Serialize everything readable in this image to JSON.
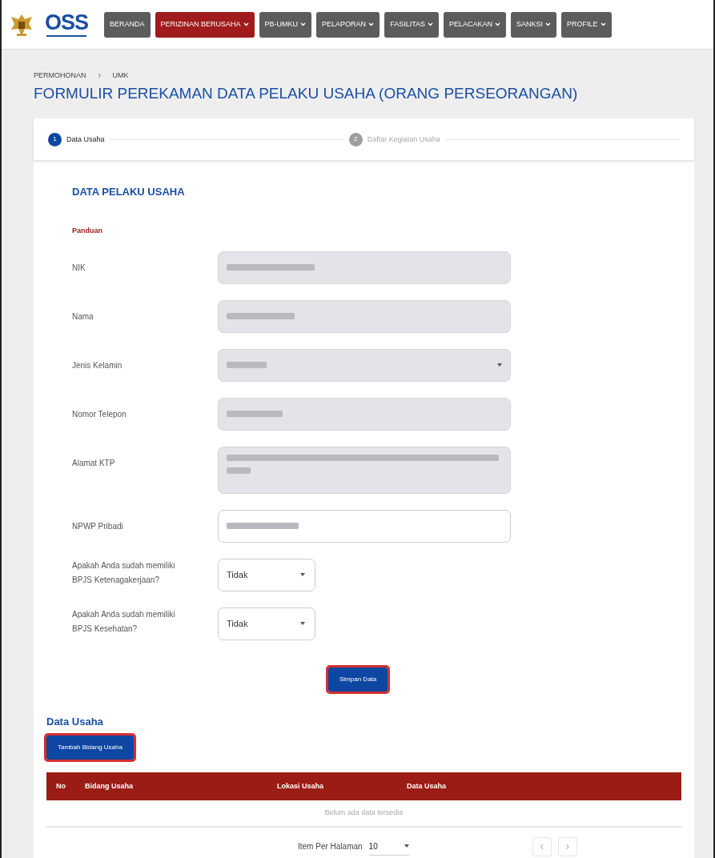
{
  "logo": {
    "text": "OSS"
  },
  "nav": [
    {
      "label": "BERANDA",
      "selected": false,
      "dropdown": false
    },
    {
      "label": "PERIZINAN BERUSAHA",
      "selected": true,
      "dropdown": true
    },
    {
      "label": "PB-UMKU",
      "selected": false,
      "dropdown": true
    },
    {
      "label": "PELAPORAN",
      "selected": false,
      "dropdown": true
    },
    {
      "label": "FASILITAS",
      "selected": false,
      "dropdown": true
    },
    {
      "label": "PELACAKAN",
      "selected": false,
      "dropdown": true
    },
    {
      "label": "SANKSI",
      "selected": false,
      "dropdown": true
    },
    {
      "label": "PROFILE",
      "selected": false,
      "dropdown": true
    }
  ],
  "breadcrumb": [
    "PERMOHONAN",
    "UMK"
  ],
  "title": "FORMULIR PEREKAMAN DATA PELAKU USAHA (ORANG PERSEORANGAN)",
  "steps": [
    {
      "number": "1",
      "label": "Data Usaha",
      "selected": true
    },
    {
      "number": "2",
      "label": "Daftar Kegiatan Usaha",
      "selected": false
    }
  ],
  "section_title": "DATA PELAKU USAHA",
  "guide_link": "Panduan",
  "fields": [
    {
      "label": "NIK",
      "kind": "text",
      "readonly": true,
      "redacted": true
    },
    {
      "label": "Nama",
      "kind": "text",
      "readonly": true,
      "redacted": true
    },
    {
      "label": "Jenis Kelamin",
      "kind": "select",
      "readonly": true,
      "redacted": true
    },
    {
      "label": "Nomor Telepon",
      "kind": "text",
      "readonly": true,
      "redacted": true
    },
    {
      "label": "Alamat KTP",
      "kind": "textarea",
      "readonly": true,
      "redacted": true
    },
    {
      "label": "NPWP Pribadi",
      "kind": "text",
      "readonly": false,
      "redacted": true
    },
    {
      "label": "Apakah Anda sudah memiliki BPJS Ketenagakerjaan?",
      "kind": "small-select",
      "readonly": false,
      "value": "Tidak"
    },
    {
      "label": "Apakah Anda sudah memiliki BPJS Kesehatan?",
      "kind": "small-select",
      "readonly": false,
      "value": "Tidak"
    }
  ],
  "save_button": {
    "label": "Simpan Data",
    "highlighted": true
  },
  "business": {
    "title": "Data Usaha",
    "add_button": {
      "label": "Tambah Bidang Usaha",
      "highlighted": true
    },
    "table": {
      "columns": [
        "No",
        "Bidang Usaha",
        "Lokasi Usaha",
        "Data Usaha"
      ],
      "empty_text": "Belum ada data tersedia"
    },
    "pagination": {
      "label": "Item Per Halaman",
      "page_size": "10"
    }
  }
}
